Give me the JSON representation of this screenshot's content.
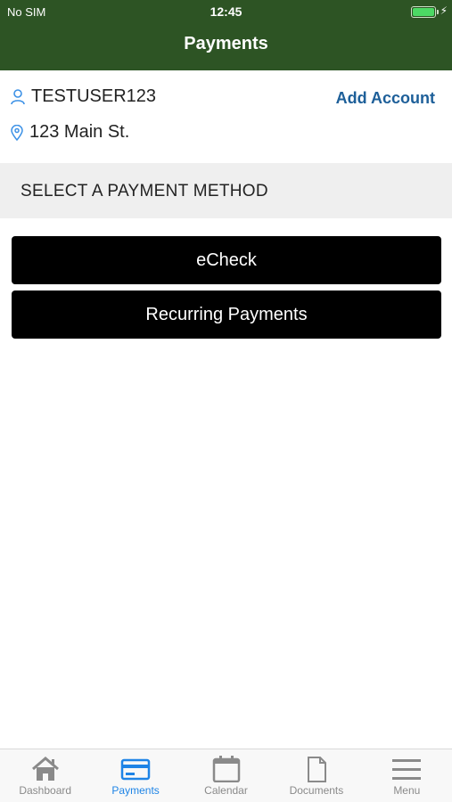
{
  "status_bar": {
    "carrier": "No SIM",
    "time": "12:45",
    "battery_level": 1.0
  },
  "header": {
    "title": "Payments"
  },
  "account": {
    "username": "TESTUSER123",
    "address": "123 Main St.",
    "add_account_label": "Add Account"
  },
  "section": {
    "label": "SELECT A PAYMENT METHOD"
  },
  "payment_methods": [
    {
      "label": "eCheck"
    },
    {
      "label": "Recurring Payments"
    }
  ],
  "tabbar": {
    "active": "Payments",
    "tabs": [
      {
        "label": "Dashboard",
        "icon": "home-icon"
      },
      {
        "label": "Payments",
        "icon": "credit-card-icon"
      },
      {
        "label": "Calendar",
        "icon": "calendar-icon"
      },
      {
        "label": "Documents",
        "icon": "document-icon"
      },
      {
        "label": "Menu",
        "icon": "menu-icon"
      }
    ]
  },
  "colors": {
    "header_bg": "#2d5424",
    "link": "#1d5f99",
    "button_bg": "#000000",
    "tab_active": "#1e84e6",
    "tab_inactive": "#8a8a8a",
    "icon_blue": "#3c91e6"
  }
}
